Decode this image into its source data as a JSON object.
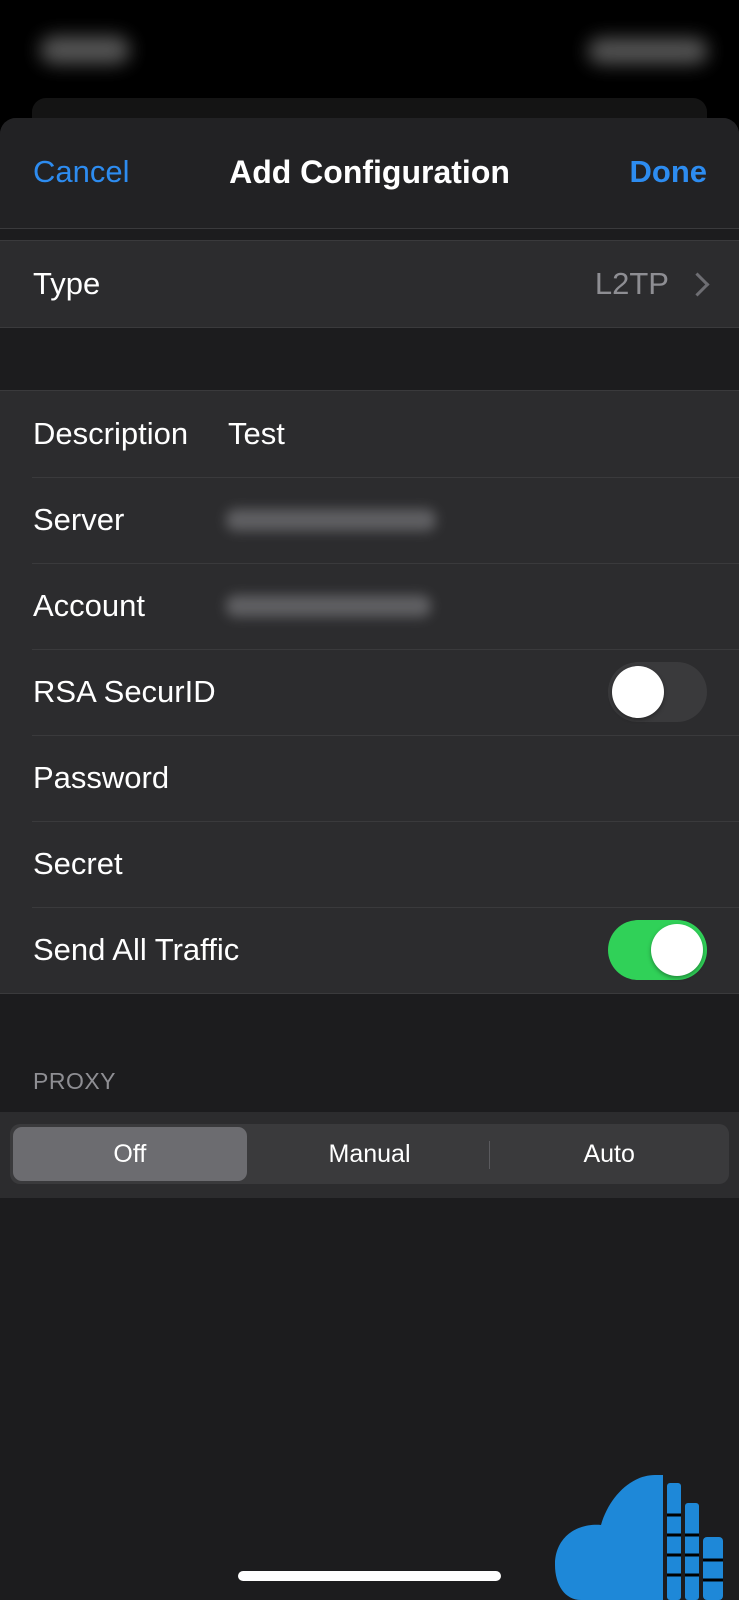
{
  "nav": {
    "cancel_label": "Cancel",
    "title": "Add Configuration",
    "done_label": "Done"
  },
  "type_row": {
    "label": "Type",
    "value": "L2TP"
  },
  "fields": {
    "description": {
      "label": "Description",
      "value": "Test"
    },
    "server": {
      "label": "Server"
    },
    "account": {
      "label": "Account"
    },
    "rsa_securid": {
      "label": "RSA SecurID",
      "enabled": false
    },
    "password": {
      "label": "Password"
    },
    "secret": {
      "label": "Secret"
    },
    "send_all_traffic": {
      "label": "Send All Traffic",
      "enabled": true
    }
  },
  "proxy": {
    "header": "PROXY",
    "options": [
      "Off",
      "Manual",
      "Auto"
    ],
    "selected": "Off"
  },
  "colors": {
    "accent": "#2d8cf0",
    "toggle_on": "#30d158",
    "logo": "#1e88d8"
  },
  "icons": {
    "chevron": "chevron-right-icon",
    "watermark": "cloud-logo-icon"
  }
}
